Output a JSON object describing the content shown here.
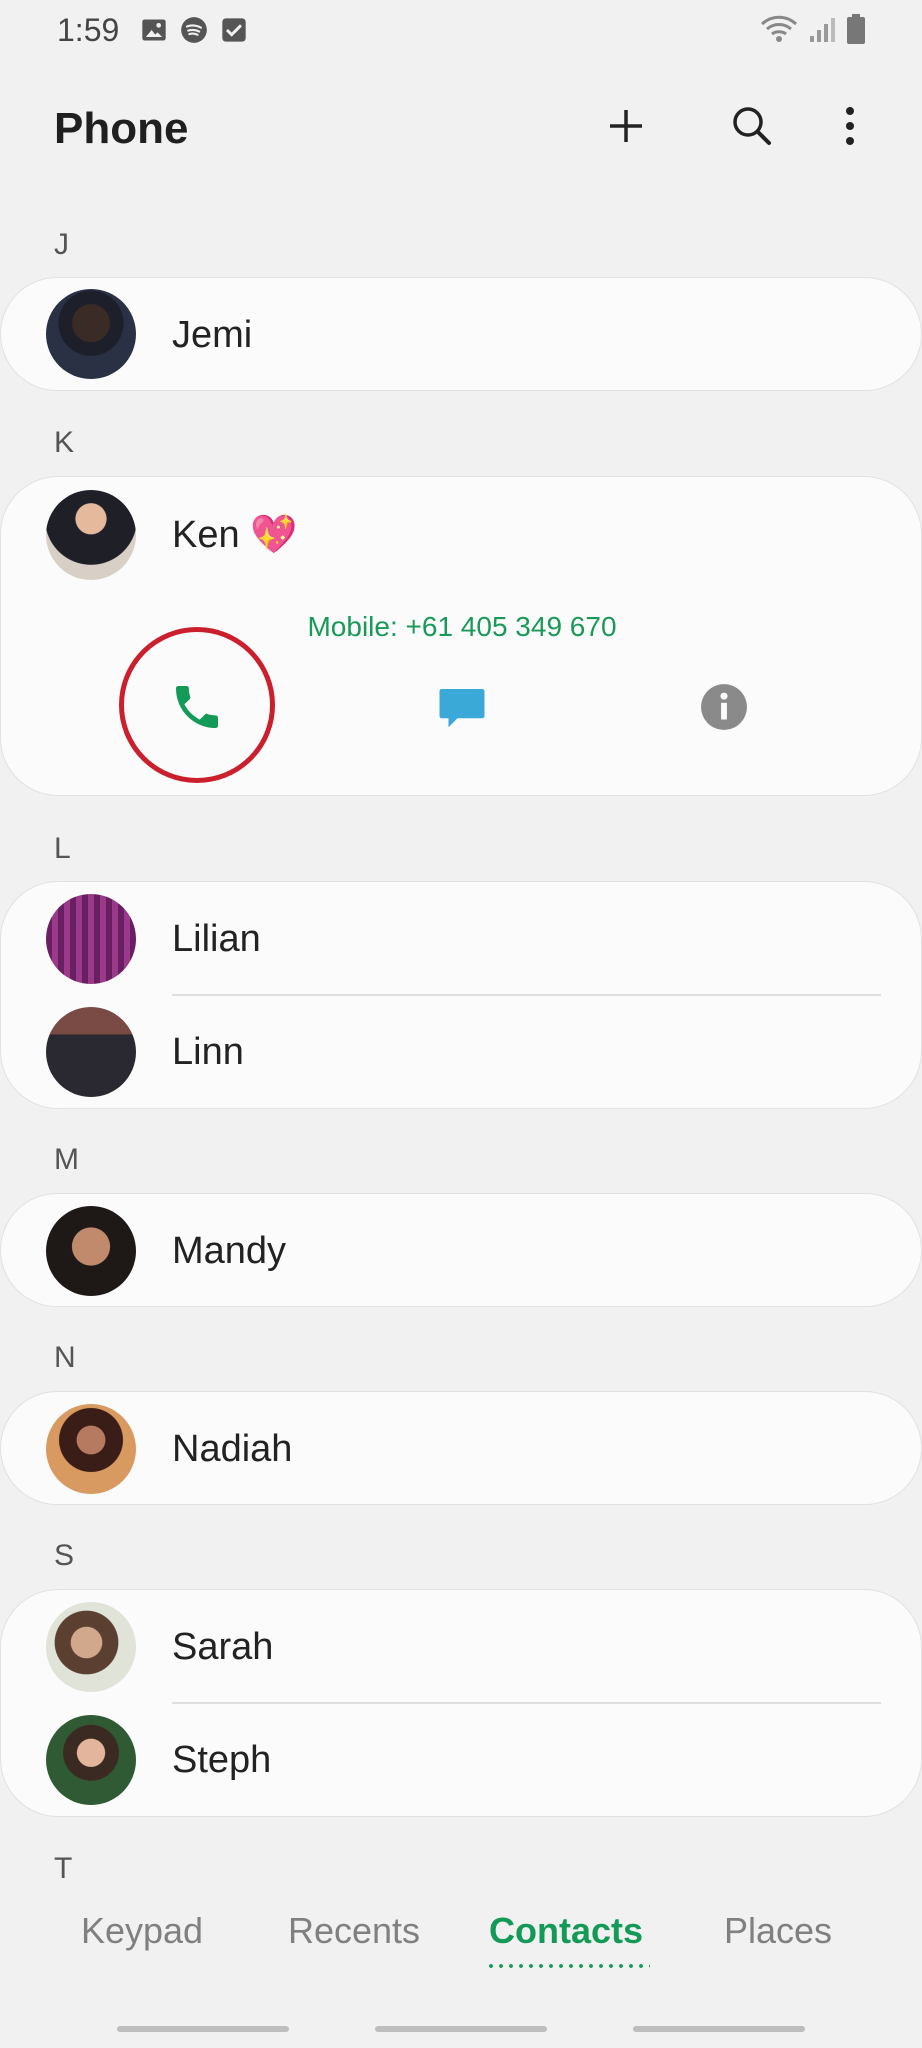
{
  "status_bar": {
    "time": "1:59",
    "icons_left": [
      "image-icon",
      "spotify-icon",
      "checkbox-icon"
    ],
    "icons_right": [
      "wifi-icon",
      "signal-icon",
      "battery-icon"
    ]
  },
  "header": {
    "title": "Phone",
    "actions": [
      "add-icon",
      "search-icon",
      "more-vert-icon"
    ]
  },
  "sections": [
    {
      "letter": "J",
      "contacts": [
        {
          "name": "Jemi"
        }
      ]
    },
    {
      "letter": "K",
      "contacts": [
        {
          "name": "Ken 💖",
          "expanded": true,
          "detail": "Mobile: +61 405 349 670"
        }
      ]
    },
    {
      "letter": "L",
      "contacts": [
        {
          "name": "Lilian"
        },
        {
          "name": "Linn"
        }
      ]
    },
    {
      "letter": "M",
      "contacts": [
        {
          "name": "Mandy"
        }
      ]
    },
    {
      "letter": "N",
      "contacts": [
        {
          "name": "Nadiah"
        }
      ]
    },
    {
      "letter": "S",
      "contacts": [
        {
          "name": "Sarah"
        },
        {
          "name": "Steph"
        }
      ]
    },
    {
      "letter": "T",
      "contacts": []
    }
  ],
  "expanded_actions": [
    "phone-call-icon",
    "message-icon",
    "info-icon"
  ],
  "tabs": {
    "items": [
      {
        "label": "Keypad"
      },
      {
        "label": "Recents"
      },
      {
        "label": "Contacts",
        "active": true
      },
      {
        "label": "Places"
      }
    ]
  },
  "colors": {
    "accent": "#139a57",
    "highlight_ring": "#cc1f2d",
    "message": "#3aa9d8",
    "info": "#8a8a8a"
  }
}
